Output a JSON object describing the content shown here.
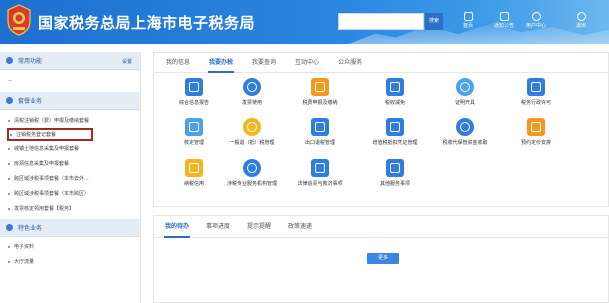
{
  "header": {
    "title": "国家税务总局上海市电子税务局",
    "search_placeholder": "",
    "search_button": "搜索",
    "buttons": [
      {
        "label": "首页",
        "icon": "home-icon"
      },
      {
        "label": "通知公告",
        "icon": "bell-icon"
      },
      {
        "label": "用户中心",
        "icon": "user-icon"
      },
      {
        "label": "退出",
        "icon": "power-icon"
      }
    ]
  },
  "sidebar": {
    "common_title": "常用功能",
    "settings_label": "设置",
    "common_items": [
      "--"
    ],
    "section_title": "套餐业务",
    "items": [
      "清税注销税（费）申报及缴纳套餐",
      "注销税务登记套餐",
      "城镇土地信息采集及申报套餐",
      "房源信息采集及申报套餐",
      "跨区域涉税事项套餐（本市去外...",
      "跨区域涉税事项套餐（本市跨区）",
      "发票核定领用套餐【税务】"
    ],
    "special_title": "特色业务",
    "special_items": [
      "电子资料",
      "大厅流量"
    ]
  },
  "main": {
    "tabs": [
      "我的信息",
      "我要办税",
      "我要查询",
      "互动中心",
      "公众服务"
    ],
    "active_tab": "我要办税",
    "functions": [
      {
        "label": "综合信息报告",
        "icon": "report-icon",
        "color": "blue"
      },
      {
        "label": "发票使用",
        "icon": "invoice-icon",
        "color": "blue"
      },
      {
        "label": "税费申报及缴纳",
        "icon": "tax-declare-icon",
        "color": "orange"
      },
      {
        "label": "税收减免",
        "icon": "tax-reduce-icon",
        "color": "blue"
      },
      {
        "label": "证明开具",
        "icon": "certificate-icon",
        "color": "lblue"
      },
      {
        "label": "税务行政许可",
        "icon": "permit-icon",
        "color": "blue"
      },
      {
        "label": "核定管理",
        "icon": "verify-icon",
        "color": "lblue"
      },
      {
        "label": "一般退（抵）税管理",
        "icon": "refund-icon",
        "color": "yellow"
      },
      {
        "label": "出口退税管理",
        "icon": "export-refund-icon",
        "color": "blue"
      },
      {
        "label": "增值税抵扣凭证管理",
        "icon": "vat-voucher-icon",
        "color": "blue"
      },
      {
        "label": "税收代保管资金收取",
        "icon": "deposit-icon",
        "color": "blue"
      },
      {
        "label": "预约定价安排",
        "icon": "pricing-icon",
        "color": "orange"
      },
      {
        "label": "纳税信用",
        "icon": "credit-icon",
        "color": "yellow"
      },
      {
        "label": "涉税专业服务机构管理",
        "icon": "agency-icon",
        "color": "blue"
      },
      {
        "label": "法律追责与救济事项",
        "icon": "legal-icon",
        "color": "blue"
      },
      {
        "label": "其他服务事项",
        "icon": "other-service-icon",
        "color": "blue"
      }
    ]
  },
  "bottom": {
    "tabs": [
      "我的待办",
      "事项进度",
      "提示提醒",
      "政策速递"
    ],
    "active_tab": "我的待办",
    "more_button": "更多"
  }
}
